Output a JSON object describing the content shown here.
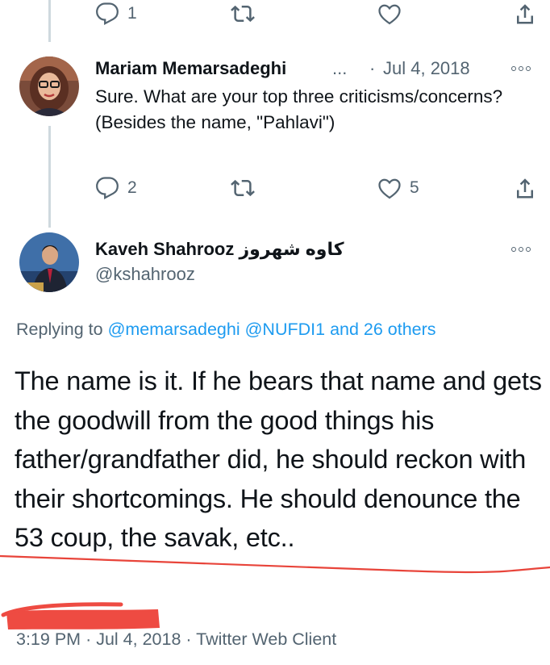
{
  "prev_tweet": {
    "reply_count": "1",
    "retweet_count": "",
    "like_count": ""
  },
  "reply_tweet": {
    "author_name": "Mariam Memarsadeghi",
    "truncation": "...",
    "separator": "·",
    "date": "Jul 4, 2018",
    "text": "Sure. What are your top three criticisms/concerns? (Besides the name, \"Pahlavi\")",
    "reply_count": "2",
    "like_count": "5"
  },
  "main_tweet": {
    "author_name": "Kaveh Shahrooz",
    "author_name_persian": "کاوه شهروز",
    "handle": "@kshahrooz",
    "replying_prefix": "Replying to",
    "replying_mention_1": "@memarsadeghi",
    "replying_mention_2": "@NUFDI1",
    "replying_others": "and 26 others",
    "text": "The name is it. If he bears that name and gets the goodwill from the good things his father/grandfather did, he should reckon with their shortcomings. He should denounce the 53 coup, the savak, etc..",
    "time": "3:19 PM",
    "separator": "·",
    "date": "Jul 4, 2018",
    "client": "Twitter Web Client"
  },
  "colors": {
    "text_primary": "#0f1419",
    "text_secondary": "#536471",
    "link": "#1d9bf0",
    "thread_line": "#cfd9de",
    "annotation_red": "#e8443a"
  },
  "icons": [
    "reply-icon",
    "retweet-icon",
    "like-icon",
    "share-icon",
    "more-icon"
  ]
}
